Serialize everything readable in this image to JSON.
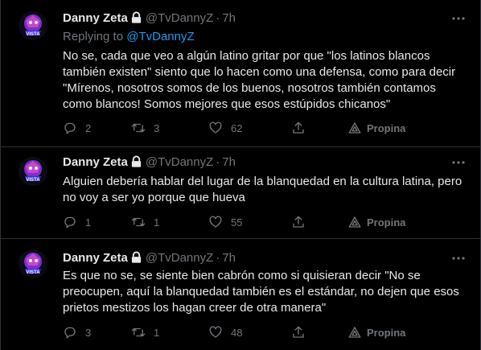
{
  "tweets": [
    {
      "author_name": "Danny Zeta",
      "handle": "@TvDannyZ",
      "dot": "·",
      "time": "7h",
      "reply_prefix": "Replying to",
      "reply_to": "@TvDannyZ",
      "lines": [
        "No se, cada que veo a algún latino gritar por que \"los latinos blancos",
        "también existen\" siento que lo hacen como una defensa, como para decir",
        "\"Mírenos, nosotros somos de los buenos, nosotros también contamos",
        "como blancos! Somos mejores que esos estúpidos chicanos\""
      ],
      "replies": "2",
      "retweets": "3",
      "likes": "62",
      "promote_label": "Propina"
    },
    {
      "author_name": "Danny Zeta",
      "handle": "@TvDannyZ",
      "dot": "·",
      "time": "7h",
      "lines": [
        "Alguien debería hablar del lugar de la blanquedad en la cultura latina, pero",
        "no voy a ser yo porque que hueva"
      ],
      "replies": "1",
      "retweets": "1",
      "likes": "55",
      "promote_label": "Propina"
    },
    {
      "author_name": "Danny Zeta",
      "handle": "@TvDannyZ",
      "dot": "·",
      "time": "7h",
      "lines": [
        "Es que no se, se siente bien cabrón como si quisieran decir \"No se",
        "preocupen, aquí la blanquedad también es el estándar, no dejen que esos",
        "prietos mestizos los hagan creer de otra manera\""
      ],
      "replies": "3",
      "retweets": "1",
      "likes": "48",
      "promote_label": "Propina"
    }
  ],
  "colors": {
    "background": "#000000",
    "text": "#e7e9ea",
    "muted": "#71767b",
    "link": "#1d9bf0",
    "divider": "#2f3336"
  },
  "icons": [
    "avatar",
    "lock-icon",
    "more-icon",
    "reply-icon",
    "retweet-icon",
    "like-icon",
    "share-icon",
    "promote-icon"
  ]
}
